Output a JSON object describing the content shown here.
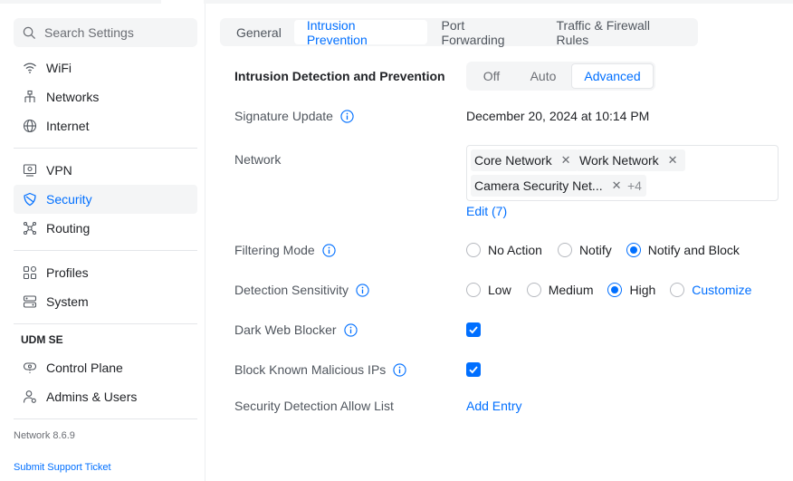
{
  "search": {
    "placeholder": "Search Settings"
  },
  "sidebar": {
    "items": [
      {
        "label": "WiFi",
        "icon": "wifi-icon"
      },
      {
        "label": "Networks",
        "icon": "network-tree-icon"
      },
      {
        "label": "Internet",
        "icon": "globe-icon"
      },
      {
        "label": "VPN",
        "icon": "vpn-icon"
      },
      {
        "label": "Security",
        "icon": "shield-icon"
      },
      {
        "label": "Routing",
        "icon": "routing-icon"
      },
      {
        "label": "Profiles",
        "icon": "profiles-icon"
      },
      {
        "label": "System",
        "icon": "system-icon"
      }
    ],
    "section_title": "UDM SE",
    "section_items": [
      {
        "label": "Control Plane",
        "icon": "control-plane-icon"
      },
      {
        "label": "Admins & Users",
        "icon": "admins-icon"
      }
    ],
    "version": "Network 8.6.9",
    "support": "Submit Support Ticket",
    "active_item": "Security"
  },
  "tabs": [
    "General",
    "Intrusion Prevention",
    "Port Forwarding",
    "Traffic & Firewall Rules"
  ],
  "active_tab": "Intrusion Prevention",
  "ids": {
    "label": "Intrusion Detection and Prevention",
    "options": [
      "Off",
      "Auto",
      "Advanced"
    ],
    "selected": "Advanced"
  },
  "signature": {
    "label": "Signature Update",
    "value": "December 20, 2024 at 10:14 PM"
  },
  "network": {
    "label": "Network",
    "chips": [
      "Core Network",
      "Work Network",
      "Camera Security Net..."
    ],
    "more": "+4",
    "edit": "Edit (7)"
  },
  "filtering": {
    "label": "Filtering Mode",
    "options": [
      "No Action",
      "Notify",
      "Notify and Block"
    ],
    "selected": "Notify and Block"
  },
  "sensitivity": {
    "label": "Detection Sensitivity",
    "options": [
      "Low",
      "Medium",
      "High",
      "Customize"
    ],
    "selected": "High"
  },
  "dark_web": {
    "label": "Dark Web Blocker",
    "checked": true
  },
  "malicious": {
    "label": "Block Known Malicious IPs",
    "checked": true
  },
  "allow_list": {
    "label": "Security Detection Allow List",
    "action": "Add Entry"
  },
  "colors": {
    "accent": "#006fff",
    "text": "#212327",
    "muted": "#50565e",
    "surface": "#f4f5f6"
  }
}
